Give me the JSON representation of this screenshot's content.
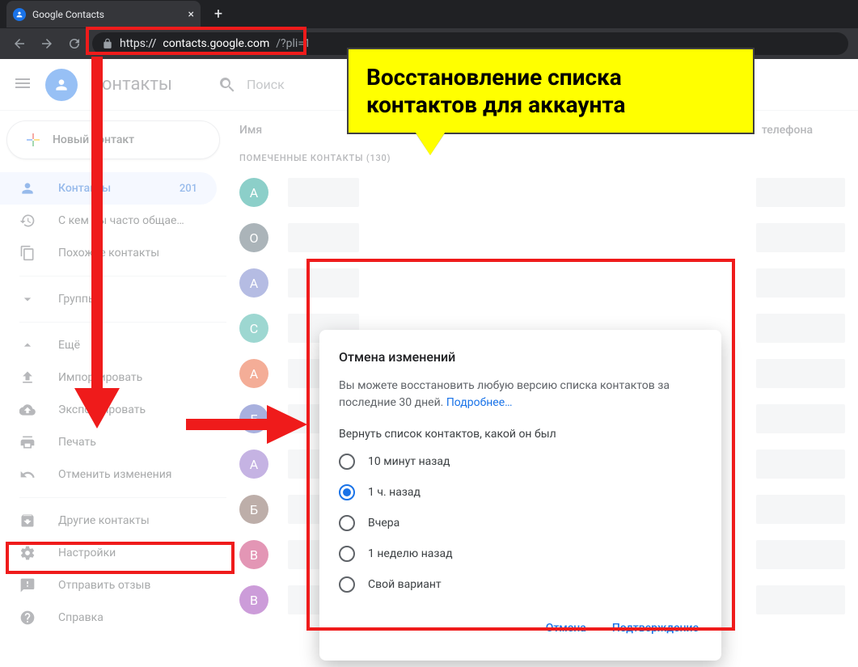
{
  "browser": {
    "tab_title": "Google Contacts",
    "url_scheme": "https://",
    "url_host": "contacts.google.com",
    "url_path": "/?pli=1"
  },
  "header": {
    "app_title": "Контакты",
    "search_label": "Поиск"
  },
  "sidebar": {
    "create_label": "Новый контакт",
    "contacts_label": "Контакты",
    "contacts_count": "201",
    "frequent_label": "С кем вы часто общае…",
    "duplicates_label": "Похожие контакты",
    "groups_label": "Группы",
    "more_label": "Ещё",
    "import_label": "Импортировать",
    "export_label": "Экспортировать",
    "print_label": "Печать",
    "undo_label": "Отменить изменения",
    "other_label": "Другие контакты",
    "settings_label": "Настройки",
    "feedback_label": "Отправить отзыв",
    "help_label": "Справка"
  },
  "main": {
    "col_name": "Имя",
    "col_phone": "телефона",
    "section_label": "ПОМЕЧЕННЫЕ КОНТАКТЫ (130)",
    "rows": [
      {
        "letter": "A",
        "color": "#009688"
      },
      {
        "letter": "O",
        "color": "#455a64"
      },
      {
        "letter": "A",
        "color": "#5c6bc0"
      },
      {
        "letter": "C",
        "color": "#26a69a"
      },
      {
        "letter": "A",
        "color": "#e64a19"
      },
      {
        "letter": "E",
        "color": "#3f51b5"
      },
      {
        "letter": "A",
        "color": "#7e57c2"
      },
      {
        "letter": "Б",
        "color": "#6d4c41"
      },
      {
        "letter": "B",
        "color": "#c2185b"
      },
      {
        "letter": "B",
        "color": "#8e24aa"
      }
    ]
  },
  "dialog": {
    "title": "Отмена изменений",
    "desc_text": "Вы можете восстановить любую версию списка контактов за последние 30 дней. ",
    "desc_link": "Подробнее…",
    "sub": "Вернуть список контактов, какой он был",
    "options": [
      "10 минут назад",
      "1 ч. назад",
      "Вчера",
      "1 неделю назад",
      "Свой вариант"
    ],
    "selected_index": 1,
    "cancel": "Отмена",
    "confirm": "Подтверждение"
  },
  "callout_text": "Восстановление списка контактов для аккаунта"
}
